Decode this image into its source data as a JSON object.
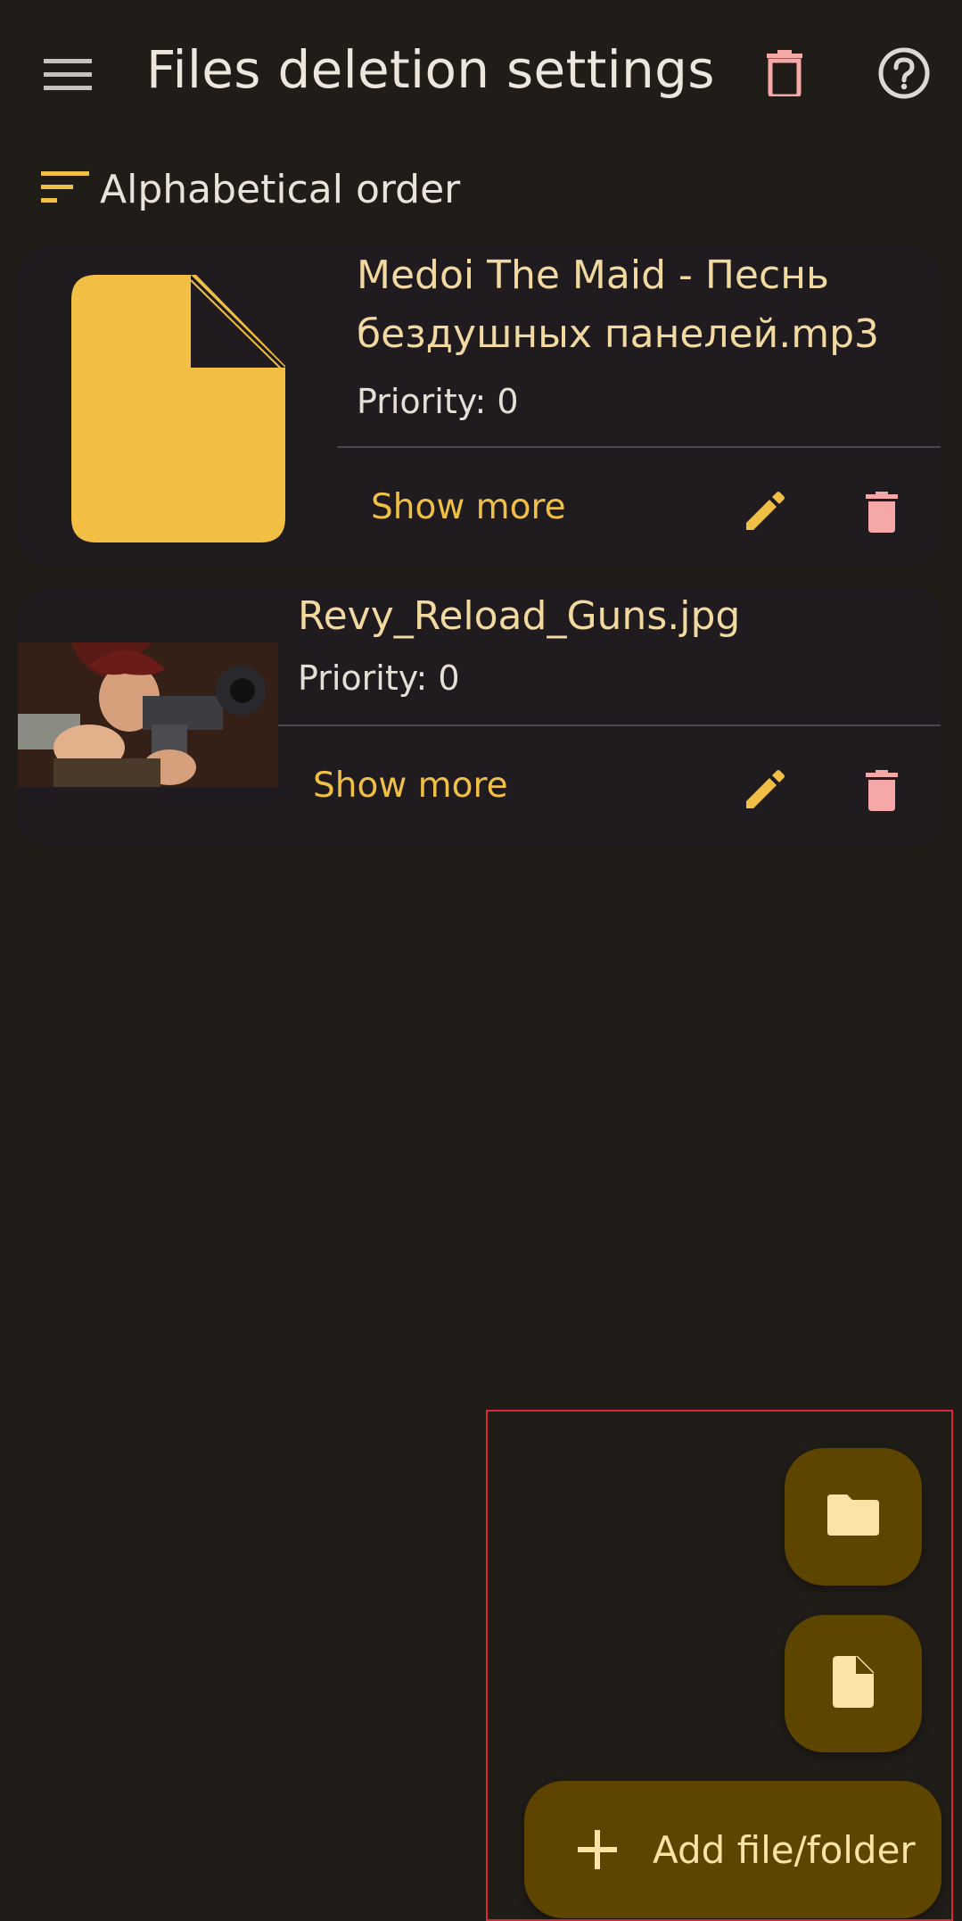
{
  "appbar": {
    "title": "Files deletion settings",
    "menu_icon": "hamburger-menu-icon",
    "trash_icon": "trash-icon",
    "help_icon": "help-circle-icon"
  },
  "sort": {
    "icon": "sort-icon",
    "label": "Alphabetical order"
  },
  "items": [
    {
      "name": "Medoi The Maid - Песнь бездушных панелей.mp3",
      "priority": "Priority: 0",
      "show_more": "Show more",
      "thumbnail": "file-icon"
    },
    {
      "name": "Revy_Reload_Guns.jpg",
      "priority": "Priority: 0",
      "show_more": "Show more",
      "thumbnail": "image-thumbnail"
    }
  ],
  "fab": {
    "folder_icon": "folder-icon",
    "file_icon": "file-icon",
    "add_label": "Add file/folder"
  },
  "colors": {
    "background": "#201c18",
    "card": "#1f1b1f",
    "accent": "#f0bf45",
    "delete": "#f6a8a8",
    "fab": "#5d4500",
    "highlight": "#d8283a"
  }
}
